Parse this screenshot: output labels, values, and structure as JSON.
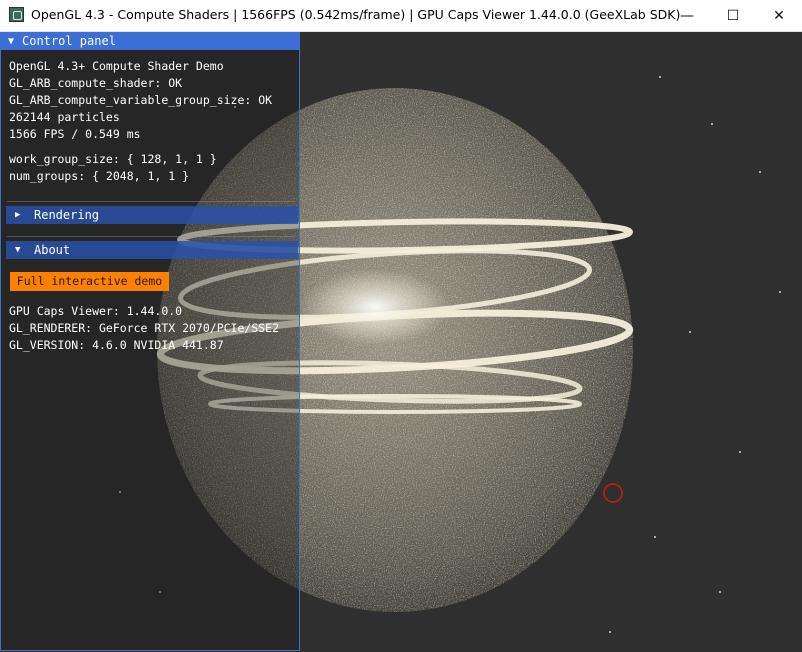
{
  "window": {
    "title": "OpenGL 4.3 - Compute Shaders | 1566FPS (0.542ms/frame) | GPU Caps Viewer 1.44.0.0 (GeeXLab SDK)",
    "minimize_glyph": "—",
    "maximize_glyph": "☐",
    "close_glyph": "✕"
  },
  "panel": {
    "title": "Control panel",
    "arrow": "▼",
    "info_lines": [
      "OpenGL 4.3+ Compute Shader Demo",
      "GL_ARB_compute_shader: OK",
      "GL_ARB_compute_variable_group_size: OK",
      "262144 particles",
      "1566 FPS / 0.549 ms"
    ],
    "params": [
      "work_group_size: { 128, 1, 1 }",
      "num_groups: { 2048, 1, 1 }"
    ],
    "rendering": {
      "label": "Rendering",
      "arrow": "▶"
    },
    "about": {
      "label": "About",
      "arrow": "▼",
      "button": "Full interactive demo",
      "lines": [
        "GPU Caps Viewer: 1.44.0.0",
        "GL_RENDERER: GeForce RTX 2070/PCIe/SSE2",
        "GL_VERSION: 4.6.0 NVIDIA 441.87"
      ]
    }
  },
  "colors": {
    "panel_header": "#3b6fd6",
    "section_header": "#2951a9",
    "button": "#ff7f00",
    "particles": "#f2ead0",
    "cursor_ring": "#d01818"
  }
}
